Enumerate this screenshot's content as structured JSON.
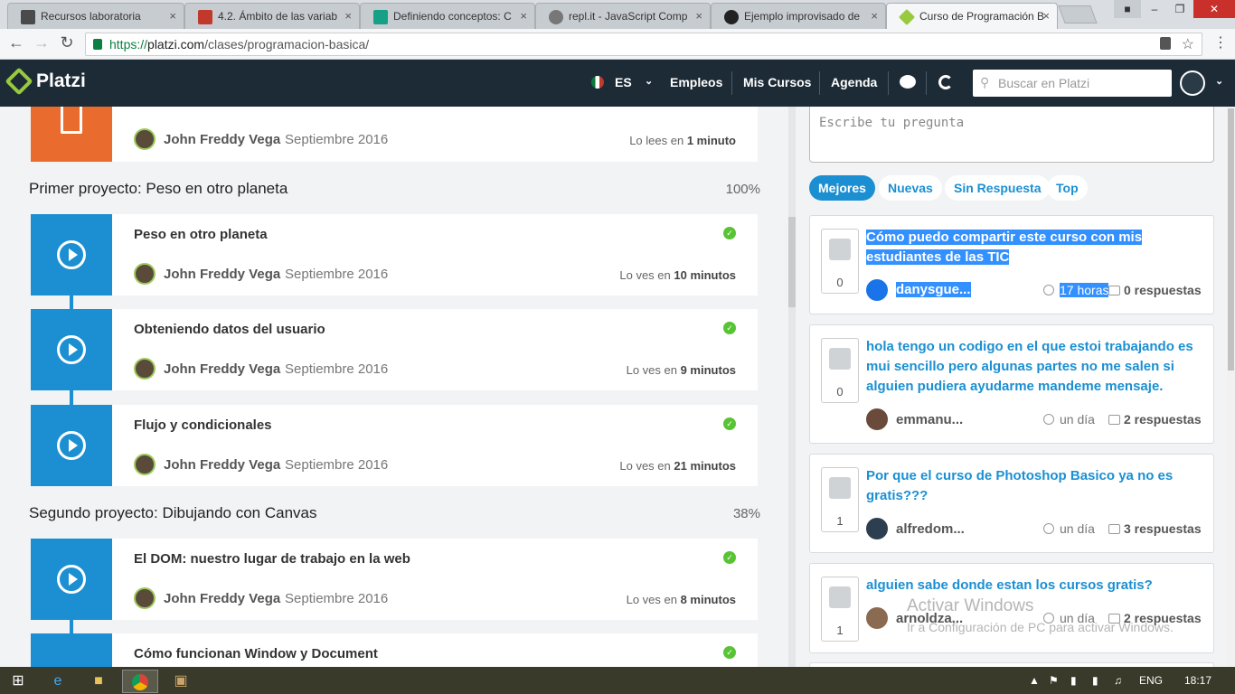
{
  "browser": {
    "tabs": [
      {
        "title": "Recursos laboratoria",
        "fav_color": "#4a4a4a"
      },
      {
        "title": "4.2. Ámbito de las variab",
        "fav_color": "#c0392b"
      },
      {
        "title": "Definiendo conceptos: C",
        "fav_color": "#16a085"
      },
      {
        "title": "repl.it - JavaScript Comp",
        "fav_color": "#777777"
      },
      {
        "title": "Ejemplo improvisado de",
        "fav_color": "#222222"
      },
      {
        "title": "Curso de Programación B",
        "fav_color": "#98ca3f"
      }
    ],
    "close_glyph": "×",
    "url_scheme": "https://",
    "url_host": "platzi.com",
    "url_path": "/clases/programacion-basica/"
  },
  "header": {
    "logo": "Platzi",
    "lang": "ES",
    "nav": [
      "Empleos",
      "Mis Cursos",
      "Agenda"
    ],
    "search_placeholder": "Buscar en Platzi"
  },
  "lessons": {
    "top_card": {
      "author": "John Freddy Vega",
      "date": "Septiembre 2016",
      "time_prefix": "Lo lees en",
      "time": "1 minuto"
    },
    "section1": {
      "title": "Primer proyecto: Peso en otro planeta",
      "percent": "100%"
    },
    "section2": {
      "title": "Segundo proyecto: Dibujando con Canvas",
      "percent": "38%"
    },
    "items": [
      {
        "title": "Peso en otro planeta",
        "author": "John Freddy Vega",
        "date": "Septiembre 2016",
        "time_prefix": "Lo ves en",
        "time": "10 minutos"
      },
      {
        "title": "Obteniendo datos del usuario",
        "author": "John Freddy Vega",
        "date": "Septiembre 2016",
        "time_prefix": "Lo ves en",
        "time": "9 minutos"
      },
      {
        "title": "Flujo y condicionales",
        "author": "John Freddy Vega",
        "date": "Septiembre 2016",
        "time_prefix": "Lo ves en",
        "time": "21 minutos"
      },
      {
        "title": "El DOM: nuestro lugar de trabajo en la web",
        "author": "John Freddy Vega",
        "date": "Septiembre 2016",
        "time_prefix": "Lo ves en",
        "time": "8 minutos"
      },
      {
        "title": "Cómo funcionan Window y Document"
      }
    ]
  },
  "questions": {
    "ask_placeholder": "Escribe tu pregunta",
    "filters": [
      "Mejores",
      "Nuevas",
      "Sin Respuesta",
      "Top"
    ],
    "items": [
      {
        "title": "Cómo puedo compartir este curso con mis estudiantes de las TIC",
        "votes": "0",
        "user": "danysgue...",
        "time": "17 horas",
        "responses": "0 respuestas"
      },
      {
        "title": "hola tengo un codigo en el que estoi trabajando es mui sencillo pero algunas partes no me salen si alguien pudiera ayudarme mandeme mensaje.",
        "votes": "0",
        "user": "emmanu...",
        "time": "un día",
        "responses": "2 respuestas"
      },
      {
        "title": "Por que el curso de Photoshop Basico ya no es gratis???",
        "votes": "1",
        "user": "alfredom...",
        "time": "un día",
        "responses": "3 respuestas"
      },
      {
        "title": "alguien sabe donde estan los cursos gratis?",
        "votes": "1",
        "user": "arnoldza...",
        "time": "un día",
        "responses": "2 respuestas"
      }
    ]
  },
  "watermark": {
    "line1": "Activar Windows",
    "line2": "Ir a Configuración de PC para activar Windows."
  },
  "taskbar": {
    "lang": "ENG",
    "clock": "18:17"
  },
  "colors": {
    "brand_green": "#98ca3f",
    "accent_blue": "#1b8fd2",
    "header_bg": "#1d2b36",
    "doc_orange": "#ea6b2e"
  }
}
